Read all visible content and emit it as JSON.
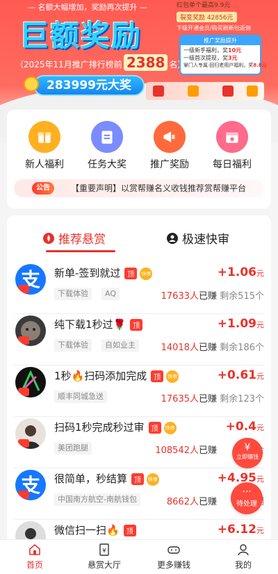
{
  "banner": {
    "slogan": "— 名额大幅增加，奖励再次提升 —",
    "title": "巨额奖励",
    "rank_prefix": "（2025年11月推广排行榜前",
    "rank_number": "2388",
    "rank_suffix": "名）",
    "prize": "283999元大奖",
    "notes": {
      "line1": "红包单个最高9.9元",
      "line2": "裂变奖励 42856元",
      "line3": "下级开通会员/购买刷新包返佣"
    },
    "promo": {
      "header": "推广奖励提升",
      "line1_prefix": "一级新手福利，奖",
      "line1_value": "10元",
      "line2_prefix": "一级首次提现，奖",
      "line2_value": "3元",
      "line3_prefix": "掌门人专属·回归老用户福利，奖",
      "line3_value": "8.8元"
    }
  },
  "menu": {
    "items": [
      {
        "label": "新人福利",
        "icon": "gift-icon",
        "color": "#ffb020"
      },
      {
        "label": "任务大奖",
        "icon": "clipboard-icon",
        "color": "#7b8cff"
      },
      {
        "label": "推广奖励",
        "icon": "megaphone-icon",
        "color": "#ff6a3d"
      },
      {
        "label": "每日福利",
        "icon": "calendar-icon",
        "color": "#ff6b8a"
      }
    ],
    "notice_tag": "公告",
    "notice_text": "【重要声明】以赏帮赚名义收钱推荐赏帮赚平台"
  },
  "tabs": {
    "recommended": "推荐悬赏",
    "fast": "极速快审"
  },
  "tasks": [
    {
      "title": "新单-签到就过",
      "top": "顶",
      "fast": "快审",
      "chips": [
        "下载体验",
        "AQ"
      ],
      "reward": "+1.06",
      "unit": "元",
      "earned": "17633人",
      "earned_suffix": "已赚",
      "remain": "剩余515个"
    },
    {
      "title": "纯下载1秒过🌹",
      "top": "顶",
      "fast": "",
      "chips": [
        "下载体验",
        "自如业主"
      ],
      "reward": "+1.09",
      "unit": "元",
      "earned": "14018人",
      "earned_suffix": "已赚",
      "remain": "剩余186个"
    },
    {
      "title": "1秒🔥扫码添加完成",
      "top": "顶",
      "fast": "快审",
      "chips": [
        "顺丰同城急送"
      ],
      "reward": "+0.61",
      "unit": "元",
      "earned": "17635人",
      "earned_suffix": "已赚",
      "remain": "剩余123个"
    },
    {
      "title": "扫码1秒完成秒过审",
      "top": "顶",
      "fast": "快审",
      "chips": [
        "美团跑腿"
      ],
      "reward": "+0.4",
      "unit": "元",
      "earned": "108542人",
      "earned_suffix": "已赚",
      "remain": "剩余"
    },
    {
      "title": "很简单，秒结算",
      "top": "顶",
      "fast": "快审",
      "chips": [
        "中国南方航空-南航钱包"
      ],
      "reward": "+4.95",
      "unit": "元",
      "earned": "8662人",
      "earned_suffix": "已赚",
      "remain": "剩"
    },
    {
      "title": "微信扫一扫🔥",
      "top": "顶",
      "fast": "",
      "chips": [],
      "reward": "+6.12",
      "unit": "元",
      "earned": "",
      "earned_suffix": "",
      "remain": ""
    }
  ],
  "float": {
    "quick_earn": "立即赚钱",
    "pending": "待处理"
  },
  "nav": {
    "home": "首页",
    "hall": "悬赏大厅",
    "more": "更多赚钱",
    "mine": "我的"
  }
}
